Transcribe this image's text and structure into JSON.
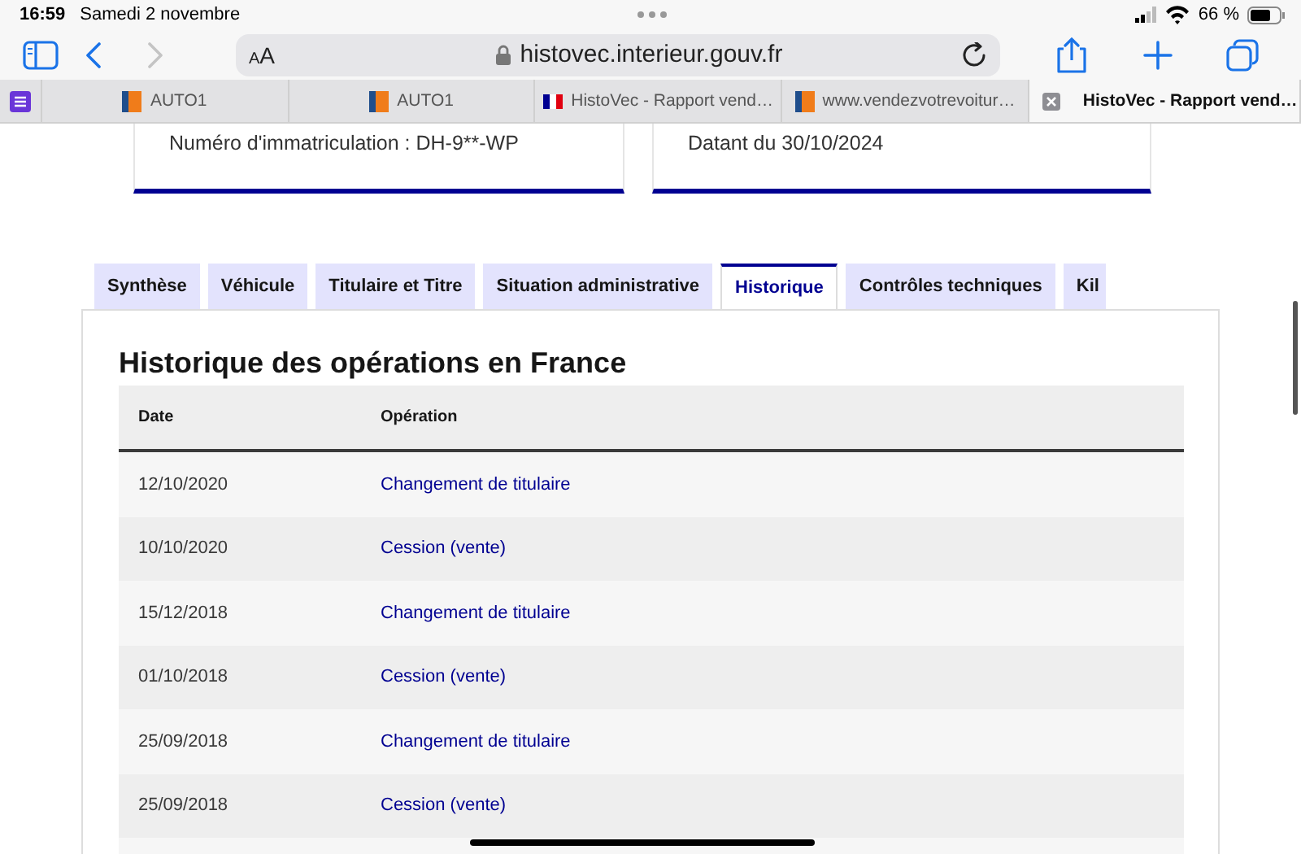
{
  "status_bar": {
    "time": "16:59",
    "date": "Samedi 2 novembre",
    "battery": "66 %"
  },
  "toolbar": {
    "reader_button": "aA",
    "url": "histovec.interieur.gouv.fr",
    "back_enabled": true,
    "forward_enabled": false
  },
  "browser_tabs": [
    {
      "kind": "auto1",
      "title": "AUTO1",
      "selected": false
    },
    {
      "kind": "auto1",
      "title": "AUTO1",
      "selected": false
    },
    {
      "kind": "france",
      "title": "HistoVec - Rapport vend…",
      "selected": false
    },
    {
      "kind": "auto1",
      "title": "www.vendezvotrevoitur…",
      "selected": false
    },
    {
      "kind": "france",
      "title": "HistoVec - Rapport vend…",
      "selected": true
    }
  ],
  "info_cards": [
    "Numéro d'immatriculation : DH-9**-WP",
    "Datant du 30/10/2024"
  ],
  "section_tabs": [
    {
      "label": "Synthèse",
      "selected": false
    },
    {
      "label": "Véhicule",
      "selected": false
    },
    {
      "label": "Titulaire et Titre",
      "selected": false
    },
    {
      "label": "Situation administrative",
      "selected": false
    },
    {
      "label": "Historique",
      "selected": true
    },
    {
      "label": "Contrôles techniques",
      "selected": false
    },
    {
      "label": "Kil",
      "selected": false
    }
  ],
  "history": {
    "title": "Historique des opérations en France",
    "columns": [
      "Date",
      "Opération"
    ],
    "rows": [
      {
        "date": "12/10/2020",
        "operation": "Changement de titulaire"
      },
      {
        "date": "10/10/2020",
        "operation": "Cession (vente)"
      },
      {
        "date": "15/12/2018",
        "operation": "Changement de titulaire"
      },
      {
        "date": "01/10/2018",
        "operation": "Cession (vente)"
      },
      {
        "date": "25/09/2018",
        "operation": "Changement de titulaire"
      },
      {
        "date": "25/09/2018",
        "operation": "Cession (vente)"
      }
    ]
  }
}
